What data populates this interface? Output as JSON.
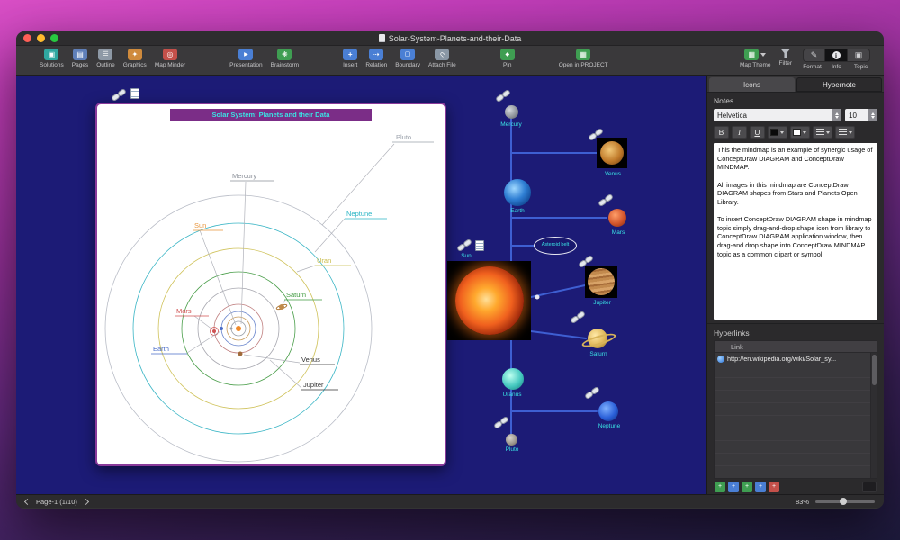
{
  "window": {
    "title": "Solar-System-Planets-and-their-Data"
  },
  "toolbar": {
    "items": [
      {
        "label": "Solutions"
      },
      {
        "label": "Pages"
      },
      {
        "label": "Outline"
      },
      {
        "label": "Graphics"
      },
      {
        "label": "Map Minder"
      },
      {
        "label": "Presentation"
      },
      {
        "label": "Brainstorm"
      },
      {
        "label": "Insert"
      },
      {
        "label": "Relation"
      },
      {
        "label": "Boundary"
      },
      {
        "label": "Attach File"
      },
      {
        "label": "Pin"
      },
      {
        "label": "Open in PROJECT"
      },
      {
        "label": "Map Theme"
      },
      {
        "label": "Filter"
      },
      {
        "label": "Format"
      },
      {
        "label": "Info",
        "active": true
      },
      {
        "label": "Topic"
      }
    ]
  },
  "diagram": {
    "title": "Solar System: Planets and their Data",
    "orbit_labels": [
      {
        "text": "Pluto",
        "color": "#9aa0aa"
      },
      {
        "text": "Mercury",
        "color": "#8a8f98"
      },
      {
        "text": "Neptune",
        "color": "#2ab5c5"
      },
      {
        "text": "Sun",
        "color": "#e8943a"
      },
      {
        "text": "Uran",
        "color": "#c9bc4a"
      },
      {
        "text": "Saturn",
        "color": "#3f9a3f"
      },
      {
        "text": "Mars",
        "color": "#d05252"
      },
      {
        "text": "Earth",
        "color": "#4a6cc8"
      },
      {
        "text": "Venus",
        "color": "#333333"
      },
      {
        "text": "Jupiter",
        "color": "#333333"
      }
    ]
  },
  "mindmap": {
    "topics": [
      {
        "label": "Sun"
      },
      {
        "label": "Mercury"
      },
      {
        "label": "Venus"
      },
      {
        "label": "Earth"
      },
      {
        "label": "Mars"
      },
      {
        "label": "Asteroid belt"
      },
      {
        "label": "Jupiter"
      },
      {
        "label": "Saturn"
      },
      {
        "label": "Uranus"
      },
      {
        "label": "Neptune"
      },
      {
        "label": "Pluto"
      }
    ]
  },
  "sidebar": {
    "tabs": [
      {
        "label": "Icons"
      },
      {
        "label": "Hypernote",
        "active": true
      }
    ],
    "notes_header": "Notes",
    "font_name": "Helvetica",
    "font_size": "10",
    "style_buttons": {
      "bold": "B",
      "italic": "I",
      "underline": "U"
    },
    "notes_text": "This the mindmap is an example of synergic usage of ConceptDraw DIAGRAM and ConceptDraw MINDMAP.\n\nAll images in this mindmap are ConceptDraw DIAGRAM shapes from Stars and Planets Open Library.\n\nTo insert ConceptDraw DIAGRAM shape in mindmap topic simply drag-and-drop shape icon from library to ConceptDraw DIAGRAM application window, then drag-and drop shape into ConceptDraw MINDMAP topic as a common clipart or symbol.",
    "hyperlinks_header": "Hyperlinks",
    "link_column_header": "Link",
    "links": [
      {
        "url": "http://en.wikipedia.org/wiki/Solar_sy..."
      }
    ]
  },
  "statusbar": {
    "page_label": "Page-1 (1/10)",
    "zoom_level": "83%"
  },
  "colors": {
    "canvas_bg": "#1c1b76",
    "panel_border": "#8a3a9a",
    "panel_titlebar": "#7b2d87",
    "mindmap_line": "#3e5fd2",
    "topic_label": "#3ae2e4"
  }
}
